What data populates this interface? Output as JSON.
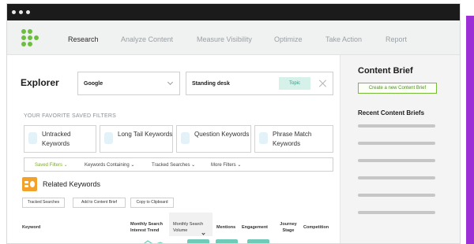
{
  "colors": {
    "accent": "#9c2fd6",
    "brand_green": "#6cbf3e",
    "topic_badge": "#d6f1ea",
    "table_pill": "#6fcab7",
    "related_icon": "#f2a12a"
  },
  "nav": {
    "items": [
      {
        "label": "Research",
        "active": true
      },
      {
        "label": "Analyze Content",
        "active": false
      },
      {
        "label": "Measure Visibility",
        "active": false
      },
      {
        "label": "Optimize",
        "active": false
      },
      {
        "label": "Take Action",
        "active": false
      },
      {
        "label": "Report",
        "active": false
      }
    ]
  },
  "explorer": {
    "title": "Explorer",
    "engine": "Google",
    "query": "Standing desk",
    "badge": "Topic"
  },
  "filters": {
    "heading": "YOUR FAVORITE SAVED FILTERS",
    "cards": [
      {
        "label": "Untracked Keywords"
      },
      {
        "label": "Long Tail Keywords"
      },
      {
        "label": "Question Keywords"
      },
      {
        "label": "Phrase Match Keywords"
      }
    ],
    "bar": [
      {
        "label": "Saved Filters ⌄",
        "active": true
      },
      {
        "label": "Keywords Containing ⌄",
        "active": false
      },
      {
        "label": "Tracked Searches ⌄",
        "active": false
      },
      {
        "label": "More Filters ⌄",
        "active": false
      }
    ]
  },
  "related": {
    "title": "Related Keywords",
    "buttons": [
      {
        "label": "Tracked Searches"
      },
      {
        "label": "Add to Content Brief"
      },
      {
        "label": "Copy to Clipboard"
      }
    ]
  },
  "table": {
    "columns": [
      {
        "label": "Keyword"
      },
      {
        "label": "Monthly Search Interest Trend"
      },
      {
        "label": "Monthly Search Volume"
      },
      {
        "label": "Mentions"
      },
      {
        "label": "Engagement"
      },
      {
        "label": "Journey Stage"
      },
      {
        "label": "Competition"
      }
    ]
  },
  "side": {
    "title": "Content Brief",
    "button": "Create a new Content Brief",
    "recent_title": "Recent Content Briefs"
  }
}
